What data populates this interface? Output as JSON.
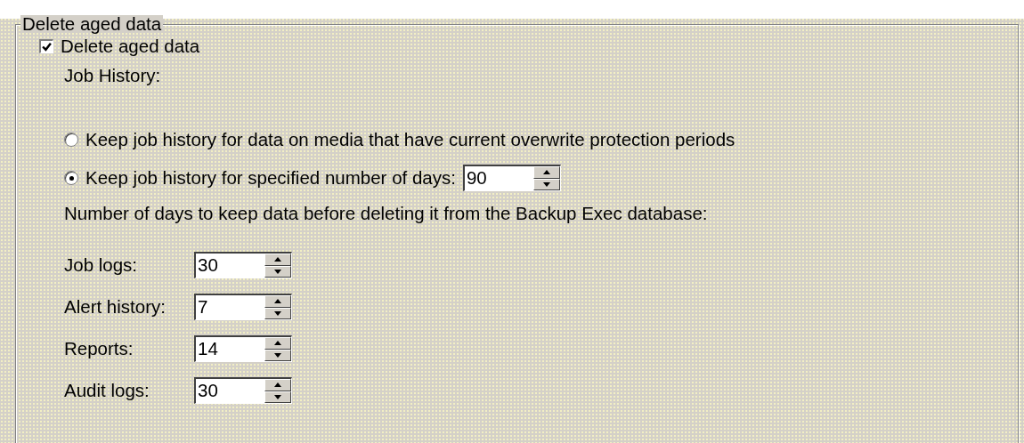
{
  "group": {
    "title": "Delete aged data"
  },
  "delete_checkbox": {
    "label": "Delete aged data",
    "checked": true
  },
  "job_history": {
    "label": "Job History:",
    "options": [
      {
        "label": "Keep job history for data on media that have current overwrite protection periods",
        "selected": false
      },
      {
        "label": "Keep job history for specified number of days:",
        "selected": true,
        "value": "90"
      }
    ]
  },
  "retention_label": "Number of days to keep data before deleting it from the Backup Exec database:",
  "retention": [
    {
      "label": "Job logs:",
      "value": "30"
    },
    {
      "label": "Alert history:",
      "value": "7"
    },
    {
      "label": "Reports:",
      "value": "14"
    },
    {
      "label": "Audit logs:",
      "value": "30"
    }
  ]
}
